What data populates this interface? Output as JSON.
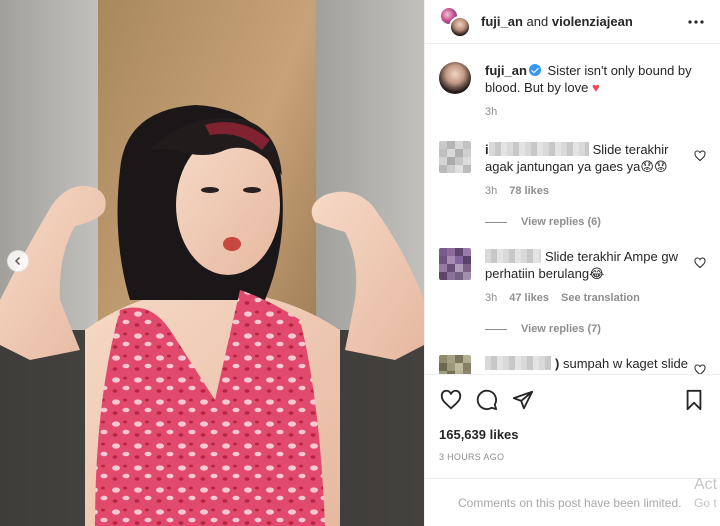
{
  "post": {
    "owner_primary": "fuji_an",
    "and_text": "and",
    "owner_secondary": "violenziajean"
  },
  "caption": {
    "username": "fuji_an",
    "text": "Sister isn't only bound by blood. But by love",
    "heart": "♥",
    "time": "3h"
  },
  "comments": [
    {
      "name_visible": "i",
      "text": "Slide terakhir agak jantungan ya gaes ya😟😟",
      "time": "3h",
      "likes": "78 likes",
      "view_replies": "View replies (6)"
    },
    {
      "name_visible": "",
      "text": "Slide terakhir Ampe gw perhatiin berulang😂",
      "time": "3h",
      "likes": "47 likes",
      "see_translation": "See translation",
      "view_replies": "View replies (7)"
    },
    {
      "name_visible": ")",
      "text": "sumpah w kaget slide terakhir, w pikir tangan uti tadi, kok"
    }
  ],
  "likes_count": "165,639 likes",
  "posted_ago": "3 hours ago",
  "comments_limited": "Comments on this post have been limited.",
  "watermark": {
    "line1": "Act",
    "line2": "Go t"
  },
  "icons": {
    "more": "more-horizontal-icon",
    "like": "heart-outline-icon",
    "comment": "speech-bubble-icon",
    "share": "paper-plane-icon",
    "save": "bookmark-icon",
    "carousel_prev": "chevron-left-icon"
  },
  "colors": {
    "verified": "#3897f0",
    "heart": "#ed4956",
    "meta_gray": "#8e8e8e"
  }
}
